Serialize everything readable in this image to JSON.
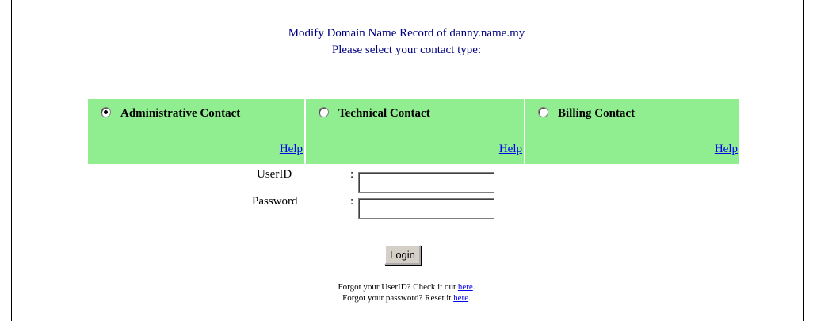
{
  "heading": {
    "title": "Modify Domain Name Record of danny.name.my",
    "subtitle": "Please select your contact type:"
  },
  "contacts": [
    {
      "label": "Administrative Contact",
      "selected": true,
      "help": "Help"
    },
    {
      "label": "Technical Contact",
      "selected": false,
      "help": "Help"
    },
    {
      "label": "Billing Contact",
      "selected": false,
      "help": "Help"
    }
  ],
  "form": {
    "userid_label": "UserID",
    "password_label": "Password",
    "colon": ":",
    "userid_value": "",
    "password_value": "",
    "login_label": "Login"
  },
  "forgot": {
    "userid_text": "Forgot your UserID? Check it out ",
    "userid_link": "here",
    "password_text": "Forgot your password? Reset it ",
    "password_link": "here",
    "period": "."
  },
  "colors": {
    "contact_bg": "#90ee90",
    "heading": "#000080",
    "link": "#0000ee"
  }
}
